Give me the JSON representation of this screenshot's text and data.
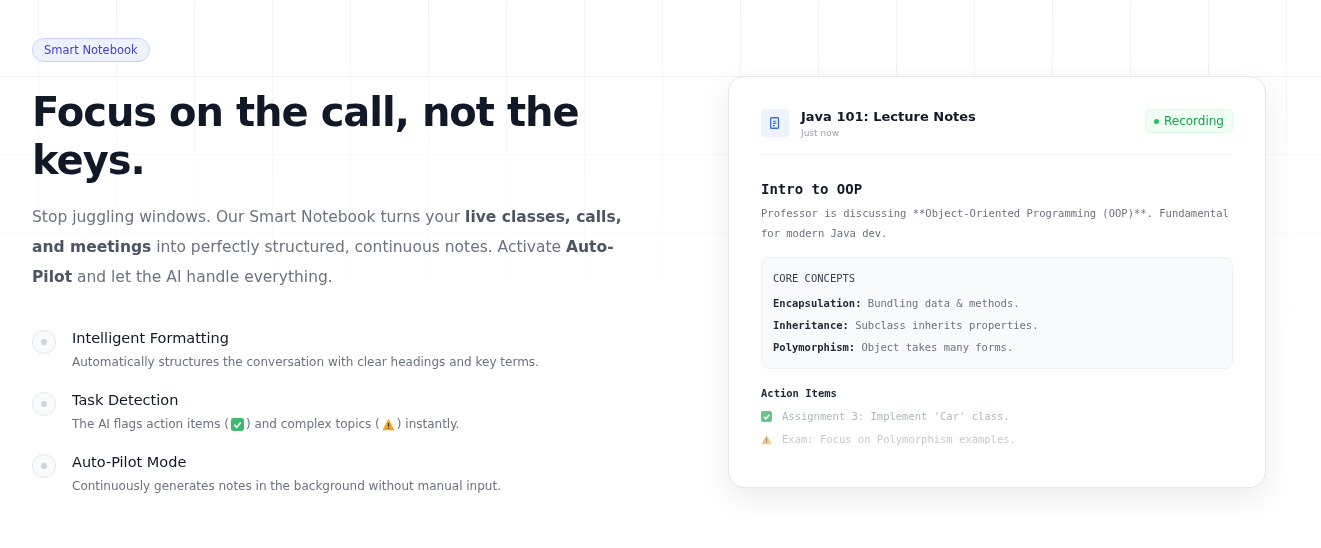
{
  "badge": "Smart Notebook",
  "headline": "Focus on the call, not the keys.",
  "intro": "Stop juggling windows. Our Smart Notebook turns your **live classes, calls, and meetings** into perfectly structured, continuous notes. Activate **Auto-Pilot** and let the AI handle everything.",
  "features": [
    {
      "title": "Intelligent Formatting",
      "description": [
        {
          "kind": "text",
          "text": "Automatically structures the conversation with clear headings and key terms."
        }
      ]
    },
    {
      "title": "Task Detection",
      "description": [
        {
          "kind": "text",
          "text": "The AI flags action items ("
        },
        {
          "kind": "check"
        },
        {
          "kind": "text",
          "text": ") and complex topics ("
        },
        {
          "kind": "warning"
        },
        {
          "kind": "text",
          "text": ") instantly."
        }
      ]
    },
    {
      "title": "Auto-Pilot Mode",
      "description": [
        {
          "kind": "text",
          "text": "Continuously generates notes in the background without manual input."
        }
      ]
    }
  ],
  "note_card": {
    "title": "Java 101: Lecture Notes",
    "time": "Just now",
    "status": "Recording",
    "heading": "Intro to OOP",
    "body": "Professor is discussing **Object-Oriented Programming (OOP)**. Fundamental for modern Java dev.",
    "concepts": {
      "title": "CORE CONCEPTS",
      "items": [
        {
          "term": "Encapsulation:",
          "definition": "Bundling data & methods."
        },
        {
          "term": "Inheritance:",
          "definition": "Subclass inherits properties."
        },
        {
          "term": "Polymorphism:",
          "definition": "Object takes many forms."
        }
      ]
    },
    "actions_title": "Action Items",
    "actions": [
      {
        "kind": "check",
        "text": "Assignment 3: Implement 'Car' class.",
        "faded": false
      },
      {
        "kind": "warning",
        "text": "Exam: Focus on Polymorphism examples.",
        "faded": true
      }
    ]
  }
}
